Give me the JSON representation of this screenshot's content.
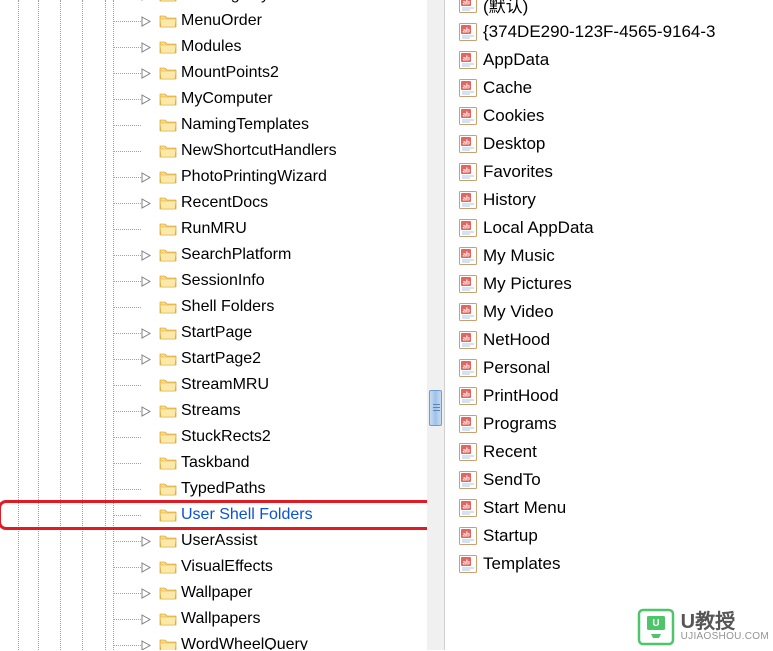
{
  "tree": {
    "items": [
      {
        "label": "LowRegistry",
        "expandable": true
      },
      {
        "label": "MenuOrder",
        "expandable": true
      },
      {
        "label": "Modules",
        "expandable": true
      },
      {
        "label": "MountPoints2",
        "expandable": true
      },
      {
        "label": "MyComputer",
        "expandable": true
      },
      {
        "label": "NamingTemplates",
        "expandable": false
      },
      {
        "label": "NewShortcutHandlers",
        "expandable": false
      },
      {
        "label": "PhotoPrintingWizard",
        "expandable": true
      },
      {
        "label": "RecentDocs",
        "expandable": true
      },
      {
        "label": "RunMRU",
        "expandable": false
      },
      {
        "label": "SearchPlatform",
        "expandable": true
      },
      {
        "label": "SessionInfo",
        "expandable": true
      },
      {
        "label": "Shell Folders",
        "expandable": false
      },
      {
        "label": "StartPage",
        "expandable": true
      },
      {
        "label": "StartPage2",
        "expandable": true
      },
      {
        "label": "StreamMRU",
        "expandable": false
      },
      {
        "label": "Streams",
        "expandable": true
      },
      {
        "label": "StuckRects2",
        "expandable": false
      },
      {
        "label": "Taskband",
        "expandable": false
      },
      {
        "label": "TypedPaths",
        "expandable": false
      },
      {
        "label": "User Shell Folders",
        "expandable": false,
        "highlighted": true
      },
      {
        "label": "UserAssist",
        "expandable": true
      },
      {
        "label": "VisualEffects",
        "expandable": true
      },
      {
        "label": "Wallpaper",
        "expandable": true
      },
      {
        "label": "Wallpapers",
        "expandable": true
      },
      {
        "label": "WordWheelQuery",
        "expandable": true
      }
    ]
  },
  "values": [
    {
      "label": "(默认)"
    },
    {
      "label": "{374DE290-123F-4565-9164-3"
    },
    {
      "label": "AppData"
    },
    {
      "label": "Cache"
    },
    {
      "label": "Cookies"
    },
    {
      "label": "Desktop"
    },
    {
      "label": "Favorites"
    },
    {
      "label": "History"
    },
    {
      "label": "Local AppData"
    },
    {
      "label": "My Music"
    },
    {
      "label": "My Pictures"
    },
    {
      "label": "My Video"
    },
    {
      "label": "NetHood"
    },
    {
      "label": "Personal"
    },
    {
      "label": "PrintHood"
    },
    {
      "label": "Programs"
    },
    {
      "label": "Recent"
    },
    {
      "label": "SendTo"
    },
    {
      "label": "Start Menu"
    },
    {
      "label": "Startup"
    },
    {
      "label": "Templates"
    }
  ],
  "watermark": {
    "title": "U教授",
    "subtitle": "UJIAOSHOU.COM"
  }
}
